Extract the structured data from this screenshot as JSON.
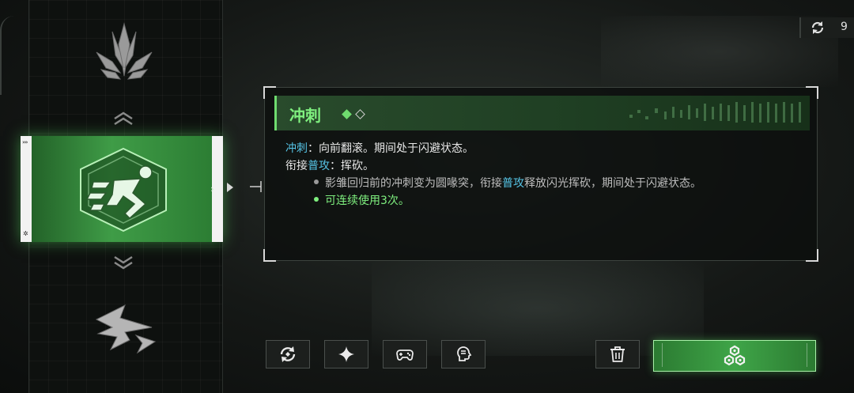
{
  "counter": {
    "icon": "refresh-icon",
    "value": "9"
  },
  "skills": {
    "top_icon": "claw-strike-icon",
    "selected_icon": "dash-runner-icon",
    "bottom_icon": "wing-slash-icon",
    "selected_markers": {
      "top": "»»",
      "bottom": "✲"
    }
  },
  "panel": {
    "title": "冲刺",
    "level_filled": 1,
    "level_total": 2,
    "desc_line1_key": "冲刺",
    "desc_line1_rest": "：向前翻滚。期间处于闪避状态。",
    "desc_line2_pre": "衔接",
    "desc_line2_key": "普攻",
    "desc_line2_rest": "：挥砍。",
    "bullet1_pre": "影雏回归前的冲刺变为圆喙突，衔接",
    "bullet1_key": "普攻",
    "bullet1_rest": "释放闪光挥砍，期间处于闪避状态。",
    "bullet2": "可连续使用3次。"
  },
  "buttons": [
    {
      "name": "swap-button",
      "icon": "swap-icon"
    },
    {
      "name": "sparkle-button",
      "icon": "sparkle-icon"
    },
    {
      "name": "gamepad-button",
      "icon": "gamepad-icon"
    },
    {
      "name": "voice-button",
      "icon": "head-speech-icon"
    },
    {
      "name": "delete-button",
      "icon": "trash-icon"
    },
    {
      "name": "confirm-button",
      "icon": "hex-cluster-icon"
    }
  ],
  "colors": {
    "accent_green": "#6fdc6f",
    "keyword_blue": "#56c4e6",
    "highlight_green": "#7ff07f"
  }
}
